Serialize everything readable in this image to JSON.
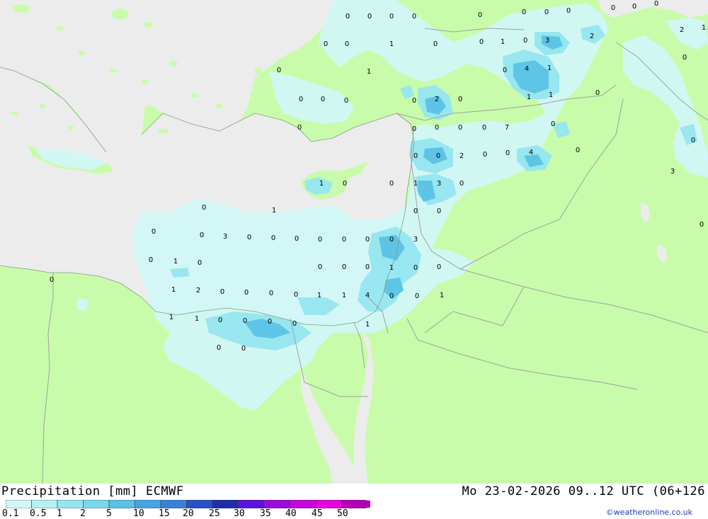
{
  "header": {
    "title": "Precipitation [mm] ECMWF",
    "valid_time": "Mo 23-02-2026 09..12 UTC (06+126",
    "credit": "©weatheronline.co.uk"
  },
  "legend": {
    "ticks": [
      "0.1",
      "0.5",
      "1",
      "2",
      "5",
      "10",
      "15",
      "20",
      "25",
      "30",
      "35",
      "40",
      "45",
      "50"
    ],
    "colors": [
      "#d2f7f7",
      "#b4f0f5",
      "#96e6f0",
      "#78d7eb",
      "#5ac3e6",
      "#46a5e1",
      "#3782d7",
      "#2850c8",
      "#1e2daa",
      "#5a14dc",
      "#9b0adc",
      "#c805dc",
      "#e600dc",
      "#b400b4"
    ]
  },
  "colors": {
    "land": "#c8fcaa",
    "sea": "#ececec",
    "precip_light": "#d2f7f7",
    "precip_mid": "#96e6f0",
    "precip_heavy": "#5ac3e6",
    "border": "#a0a0a0"
  },
  "map_labels": [
    "0",
    "0",
    "0",
    "0",
    "0",
    "0",
    "0",
    "0",
    "0",
    "0",
    "0",
    "0",
    "0",
    "1",
    "0",
    "0",
    "1",
    "0",
    "3",
    "2",
    "2",
    "1",
    "0",
    "4",
    "1",
    "0",
    "1",
    "0",
    "1",
    "1",
    "0",
    "0",
    "0",
    "2",
    "0",
    "0",
    "0",
    "0",
    "0",
    "0",
    "0",
    "0",
    "7",
    "0",
    "0",
    "0",
    "0",
    "0",
    "2",
    "0",
    "0",
    "4",
    "3",
    "1",
    "0",
    "0",
    "1",
    "3",
    "0",
    "0",
    "1",
    "0",
    "0",
    "0",
    "0",
    "0",
    "3",
    "0",
    "0",
    "0",
    "0",
    "0",
    "0",
    "0",
    "3",
    "0",
    "1",
    "0",
    "0",
    "0",
    "0",
    "1",
    "0",
    "0",
    "0",
    "1",
    "2",
    "0",
    "0",
    "0",
    "0",
    "1",
    "1",
    "4",
    "0",
    "0",
    "1",
    "1",
    "1",
    "0",
    "0",
    "0",
    "0",
    "1",
    "0",
    "0"
  ]
}
